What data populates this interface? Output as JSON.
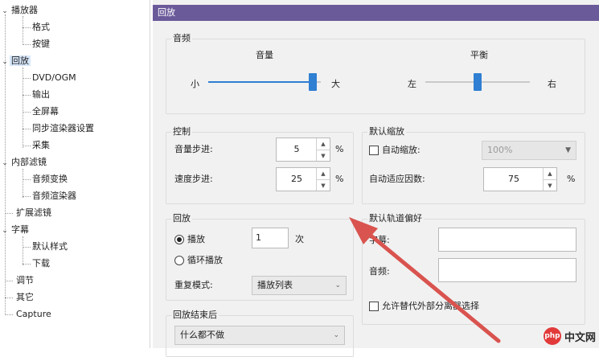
{
  "tree": [
    {
      "label": "播放器",
      "expander": "⌄",
      "level": 0
    },
    {
      "label": "格式",
      "level": 1
    },
    {
      "label": "按键",
      "level": 1
    },
    {
      "label": "回放",
      "expander": "⌄",
      "level": 0,
      "selected": true
    },
    {
      "label": "DVD/OGM",
      "level": 1
    },
    {
      "label": "输出",
      "level": 1
    },
    {
      "label": "全屏幕",
      "level": 1
    },
    {
      "label": "同步渲染器设置",
      "level": 1
    },
    {
      "label": "采集",
      "level": 1
    },
    {
      "label": "内部滤镜",
      "expander": "⌄",
      "level": 0
    },
    {
      "label": "音频变换",
      "level": 1
    },
    {
      "label": "音频渲染器",
      "level": 1
    },
    {
      "label": "扩展滤镜",
      "level": 0
    },
    {
      "label": "字幕",
      "expander": "⌄",
      "level": 0
    },
    {
      "label": "默认样式",
      "level": 1
    },
    {
      "label": "下载",
      "level": 1
    },
    {
      "label": "调节",
      "level": 0
    },
    {
      "label": "其它",
      "level": 0
    },
    {
      "label": "Capture",
      "level": 0
    }
  ],
  "header": {
    "title": "回放"
  },
  "audio": {
    "title": "音频",
    "volume": {
      "label": "音量",
      "min_label": "小",
      "max_label": "大",
      "value": 0.93
    },
    "balance": {
      "label": "平衡",
      "left_label": "左",
      "right_label": "右",
      "value": 0.5
    }
  },
  "control": {
    "title": "控制",
    "volume_step": {
      "label": "音量步进:",
      "value": "5",
      "unit": "%"
    },
    "speed_step": {
      "label": "速度步进:",
      "value": "25",
      "unit": "%"
    }
  },
  "default_zoom": {
    "title": "默认缩放",
    "auto_zoom": {
      "label": "自动缩放:",
      "checked": false
    },
    "zoom_value": "100%",
    "auto_fit": {
      "label": "自动适应因数:",
      "value": "75",
      "unit": "%"
    }
  },
  "playback": {
    "title": "回放",
    "play": {
      "label": "播放",
      "selected": true
    },
    "times_value": "1",
    "times_unit": "次",
    "loop": {
      "label": "循环播放",
      "selected": false
    },
    "repeat_mode": {
      "label": "重复模式:",
      "value": "播放列表"
    }
  },
  "after_playback": {
    "title": "回放结束后",
    "value": "什么都不做"
  },
  "track_pref": {
    "title": "默认轨道偏好",
    "subtitle_label": "字幕:",
    "audio_label": "音频:",
    "allow_external": {
      "label": "允许替代外部分离器选择",
      "checked": false
    }
  },
  "watermark": {
    "logo": "php",
    "text": "中文网"
  },
  "colors": {
    "accent": "#2f7fd2",
    "titlebar": "#6b5a9a",
    "arrow": "#d9534f"
  }
}
